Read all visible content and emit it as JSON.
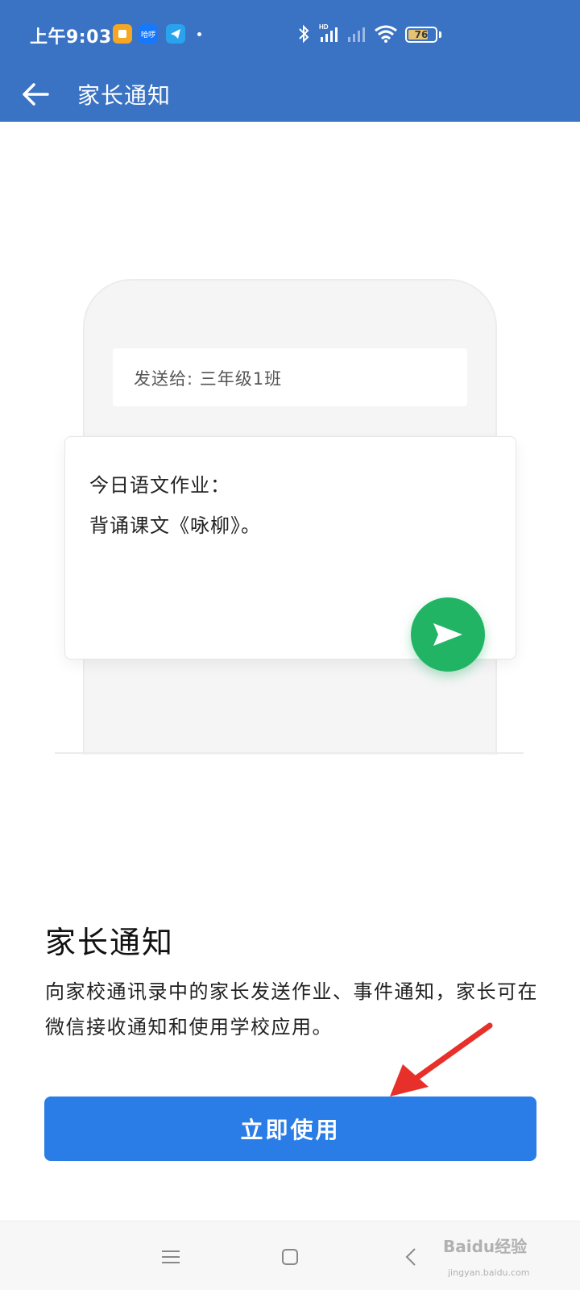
{
  "status_bar": {
    "time": "上午9:03",
    "app_badge_2": "哈啰",
    "battery_level": "76",
    "icons": [
      "notes-app-icon",
      "hello-app-icon",
      "telegram-icon",
      "bluetooth-icon",
      "signal-hd-icon",
      "signal-icon",
      "wifi-icon",
      "battery-icon"
    ]
  },
  "app_bar": {
    "title": "家长通知",
    "back_icon": "arrow-left-icon"
  },
  "illustration": {
    "recipient_text": "发送给: 三年级1班",
    "message_line_1": "今日语文作业：",
    "message_line_2": "背诵课文《咏柳》。",
    "send_icon": "send-icon",
    "send_color": "#22b465"
  },
  "feature": {
    "title": "家长通知",
    "description": "向家校通讯录中的家长发送作业、事件通知，家长可在微信接收通知和使用学校应用。"
  },
  "primary_button": {
    "label": "立即使用",
    "color": "#2a7de6"
  },
  "nav_bar": {
    "icons": [
      "menu-icon",
      "home-icon",
      "back-icon"
    ]
  },
  "watermark": {
    "text": "Baidu经验",
    "sub": "jingyan.baidu.com"
  },
  "colors": {
    "header": "#3a73c4",
    "annotation_arrow": "#e8302a"
  }
}
